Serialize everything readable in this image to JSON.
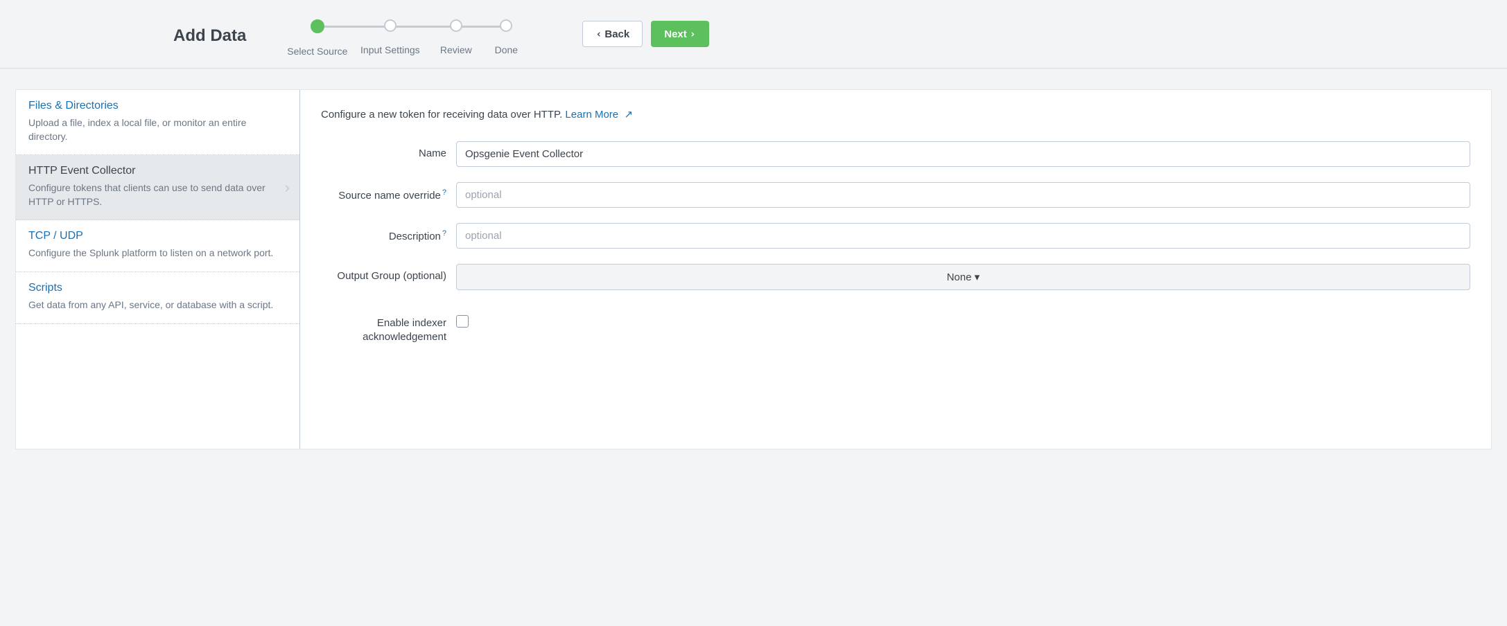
{
  "header": {
    "title": "Add Data",
    "steps": [
      "Select Source",
      "Input Settings",
      "Review",
      "Done"
    ],
    "back_label": "Back",
    "next_label": "Next"
  },
  "sidebar": {
    "items": [
      {
        "title": "Files & Directories",
        "desc": "Upload a file, index a local file, or monitor an entire directory."
      },
      {
        "title": "HTTP Event Collector",
        "desc": "Configure tokens that clients can use to send data over HTTP or HTTPS."
      },
      {
        "title": "TCP / UDP",
        "desc": "Configure the Splunk platform to listen on a network port."
      },
      {
        "title": "Scripts",
        "desc": "Get data from any API, service, or database with a script."
      }
    ]
  },
  "content": {
    "intro": "Configure a new token for receiving data over HTTP.",
    "learn_more": "Learn More",
    "labels": {
      "name": "Name",
      "source_override": "Source name override",
      "description": "Description",
      "output_group": "Output Group (optional)",
      "enable_ack": "Enable indexer acknowledgement"
    },
    "values": {
      "name": "Opsgenie Event Collector",
      "output_group": "None"
    },
    "placeholders": {
      "optional": "optional"
    }
  }
}
